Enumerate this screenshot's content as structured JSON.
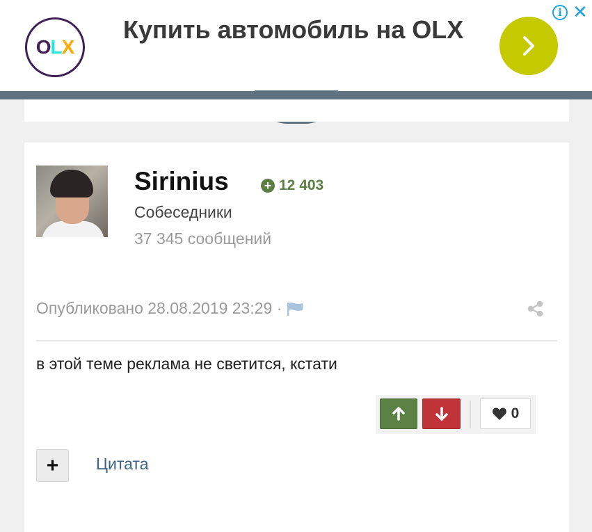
{
  "ad": {
    "logo_text": [
      "O",
      "L",
      "X"
    ],
    "title": "Купить автомобиль на OLX",
    "go_icon": "chevron-right-icon",
    "info_icon": "info-icon",
    "close_icon": "close-icon",
    "info_symbol": "i",
    "close_symbol": "✕"
  },
  "post": {
    "author": "Sirinius",
    "reputation": "12 403",
    "reputation_icon": "+",
    "group": "Собеседники",
    "post_count": "37 345 сообщений",
    "published": "Опубликовано 28.08.2019 23:29 ·",
    "content": "в этой теме реклама не светится, кстати",
    "likes": "0",
    "quote_label": "Цитата",
    "multiquote_label": "+"
  },
  "colors": {
    "ad_button": "#c5c900",
    "tab": "#5e7281",
    "reputation": "#5b7f43",
    "vote_up": "#5b8144",
    "vote_down": "#c03339",
    "link": "#3a6288"
  }
}
